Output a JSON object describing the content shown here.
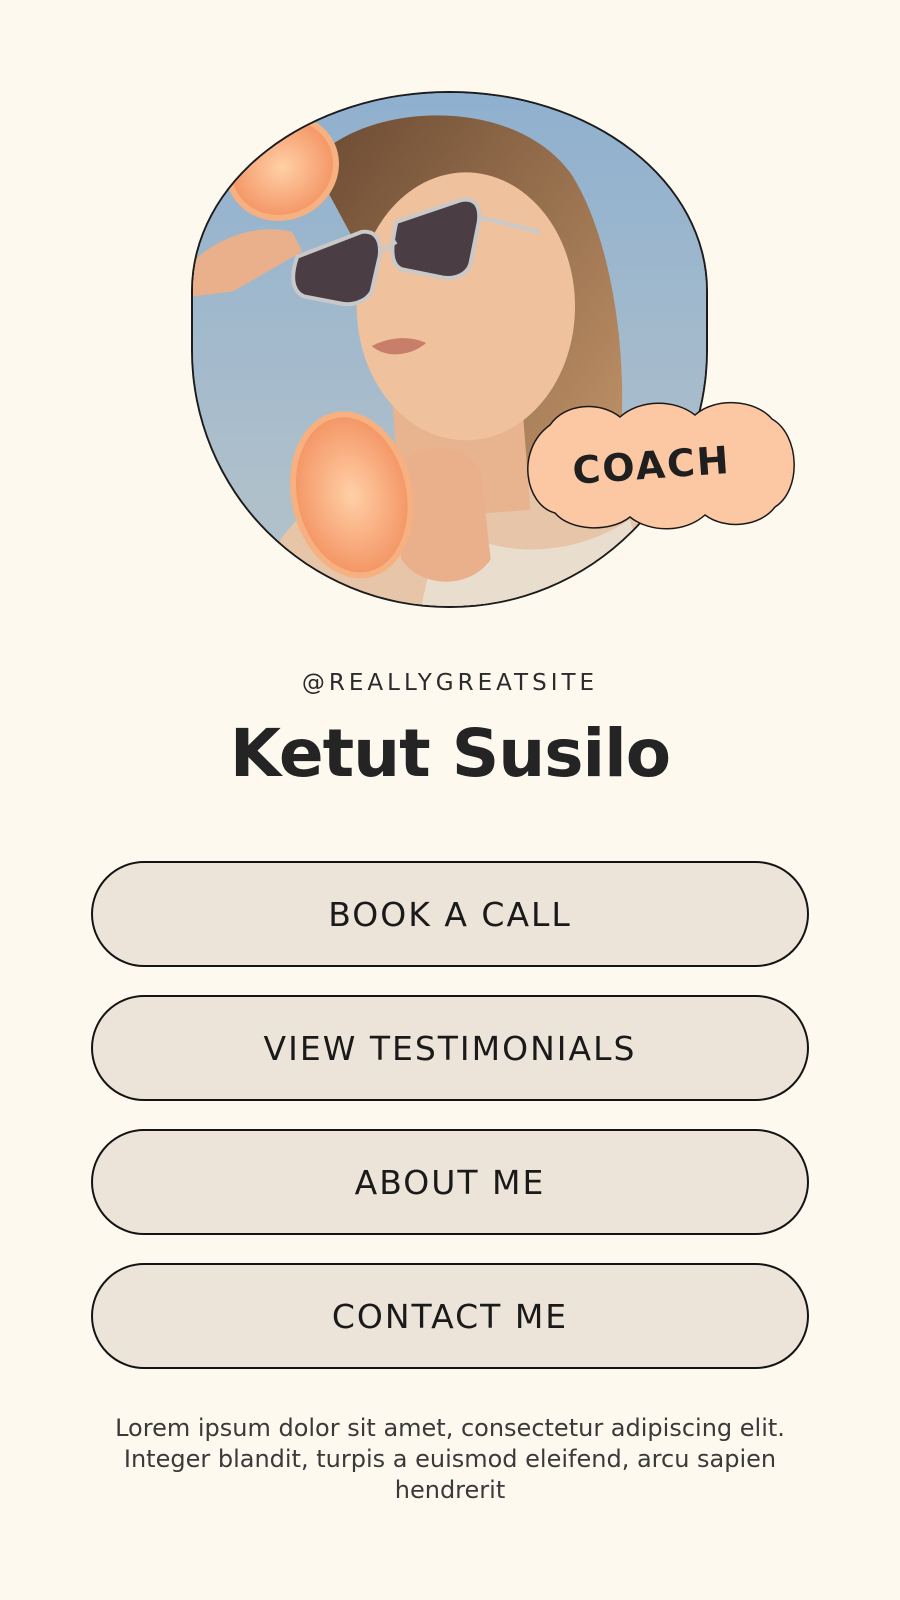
{
  "profile": {
    "photo_alt": "portrait photo",
    "badge": "COACH",
    "handle": "@REALLYGREATSITE",
    "name": "Ketut Susilo"
  },
  "links": [
    {
      "label": "BOOK A CALL"
    },
    {
      "label": "VIEW TESTIMONIALS"
    },
    {
      "label": "ABOUT ME"
    },
    {
      "label": "CONTACT ME"
    }
  ],
  "footer": {
    "text": "Lorem ipsum dolor sit amet, consectetur adipiscing elit. Integer blandit, turpis a euismod eleifend, arcu sapien hendrerit"
  },
  "colors": {
    "background": "#fdf9ef",
    "button_fill": "#ece4d8",
    "badge_fill": "#fcc8a4",
    "outline": "#141414"
  }
}
